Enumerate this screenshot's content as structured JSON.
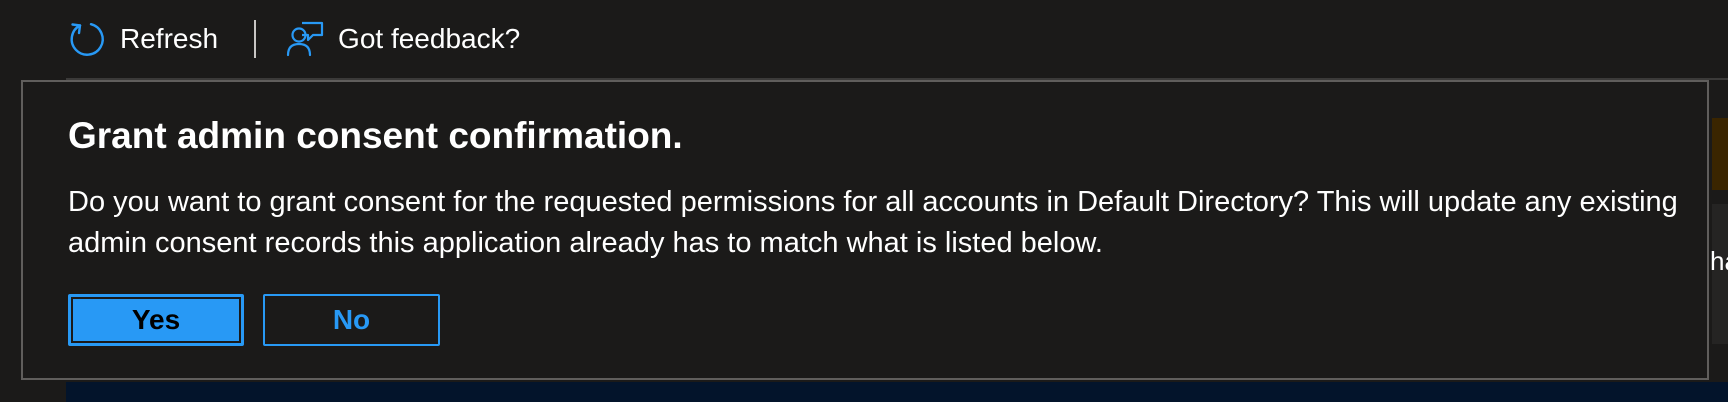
{
  "toolbar": {
    "refresh_label": "Refresh",
    "feedback_label": "Got feedback?",
    "icons": {
      "refresh": "refresh-icon",
      "feedback": "feedback-icon"
    }
  },
  "dialog": {
    "title": "Grant admin consent confirmation.",
    "message": "Do you want to grant consent for the requested permissions for all accounts in Default Directory? This will update any existing admin consent records this application already has to match what is listed below.",
    "yes_label": "Yes",
    "no_label": "No"
  },
  "background": {
    "right_edge_text": "ha"
  },
  "colors": {
    "accent": "#2899f5",
    "background": "#1b1a19",
    "dialog_border": "#605e5c",
    "bottom_band": "#03142b"
  }
}
